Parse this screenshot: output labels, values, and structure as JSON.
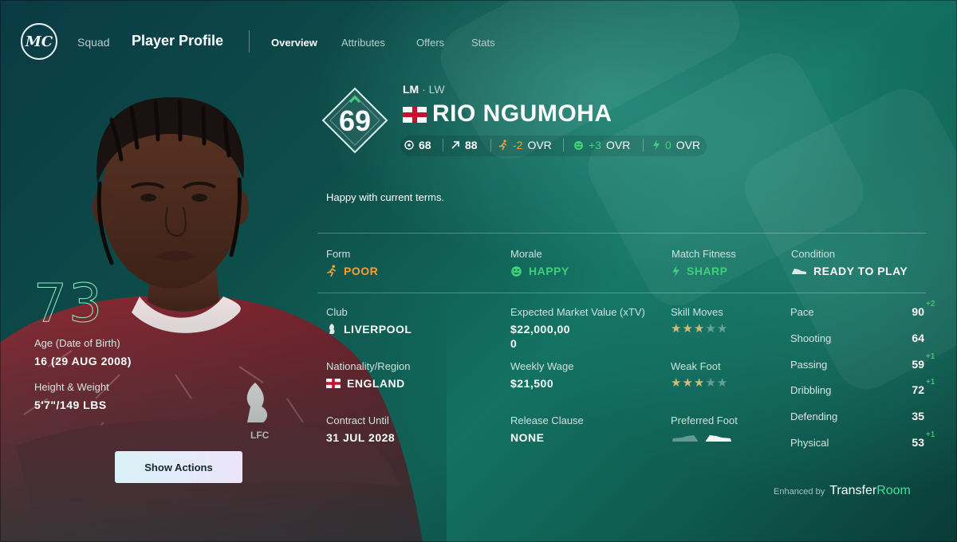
{
  "nav": {
    "logo": "MC",
    "squad": "Squad",
    "title": "Player Profile",
    "tabs": [
      "Overview",
      "Attributes",
      "Offers",
      "Stats"
    ]
  },
  "player": {
    "big_rating": "73",
    "age_label": "Age (Date of Birth)",
    "age_value": "16 (29 AUG 2008)",
    "height_label": "Height & Weight",
    "height_value": "5'7\"/149 LBS",
    "show_actions": "Show Actions"
  },
  "header": {
    "ovr": "69",
    "position_main": "LM",
    "position_sep": " · ",
    "position_alt": "LW",
    "name": "RIO NGUMOHA",
    "chips": [
      {
        "icon": "target-icon",
        "value": "68",
        "color": "#ffffff"
      },
      {
        "icon": "arrow-up-right-icon",
        "value": "88",
        "color": "#ffffff"
      },
      {
        "icon": "runner-icon",
        "value": "-2",
        "suffix": "OVR",
        "color": "#f4a13c"
      },
      {
        "icon": "smiley-icon",
        "value": "+3",
        "suffix": "OVR",
        "color": "#3fd07a"
      },
      {
        "icon": "lightning-icon",
        "value": "0",
        "suffix": "OVR",
        "color": "#3fd07a"
      }
    ],
    "status": "Happy with current terms."
  },
  "summary": {
    "form_label": "Form",
    "form_value": "POOR",
    "morale_label": "Morale",
    "morale_value": "HAPPY",
    "fitness_label": "Match Fitness",
    "fitness_value": "SHARP",
    "condition_label": "Condition",
    "condition_value": "READY TO PLAY"
  },
  "details": {
    "club_label": "Club",
    "club_value": "LIVERPOOL",
    "xtv_label": "Expected Market Value (xTV)",
    "xtv_value_1": "$22,000,00",
    "xtv_value_2": "0",
    "skill_label": "Skill Moves",
    "skill_stars": 3,
    "nation_label": "Nationality/Region",
    "nation_value": "ENGLAND",
    "wage_label": "Weekly Wage",
    "wage_value": "$21,500",
    "weakfoot_label": "Weak Foot",
    "weakfoot_stars": 3,
    "contract_label": "Contract Until",
    "contract_value": "31 JUL 2028",
    "release_label": "Release Clause",
    "release_value": "NONE",
    "foot_label": "Preferred Foot",
    "preferred_foot": "right"
  },
  "attributes": [
    {
      "label": "Pace",
      "value": "90",
      "delta": "+2"
    },
    {
      "label": "Shooting",
      "value": "64",
      "delta": ""
    },
    {
      "label": "Passing",
      "value": "59",
      "delta": "+1"
    },
    {
      "label": "Dribbling",
      "value": "72",
      "delta": "+1"
    },
    {
      "label": "Defending",
      "value": "35",
      "delta": ""
    },
    {
      "label": "Physical",
      "value": "53",
      "delta": "+1"
    }
  ],
  "footer": {
    "enhanced_by": "Enhanced by",
    "brand_a": "Transfer",
    "brand_b": "Room"
  },
  "colors": {
    "accent_green": "#3fd07a",
    "accent_orange": "#f4a13c",
    "rating_outline": "#8ff0c0",
    "star_on": "#d4b978"
  }
}
